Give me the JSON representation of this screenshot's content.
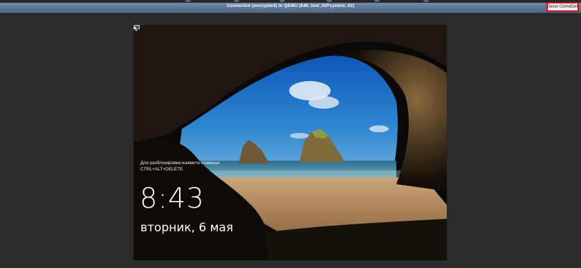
{
  "window": {
    "title": "Connected (encrypted) to QEMU (646_test_ISPsystem_02)"
  },
  "toolbar": {
    "send_ctrl_alt_del_label": "Send CtrlAltDel"
  },
  "lockscreen": {
    "unlock_hint_line1": "Для разблокировки нажмите клавиши",
    "unlock_hint_line2": "CTRL+ALT+DELETE.",
    "time": "8:43",
    "date": "вторник, 6 мая"
  },
  "icons": {
    "network": "network-status-icon",
    "cursor": "mouse-pointer-icon"
  },
  "colors": {
    "titlebar": "#5f7898",
    "highlight_border": "#c21018",
    "page_background": "#2b2a29"
  }
}
